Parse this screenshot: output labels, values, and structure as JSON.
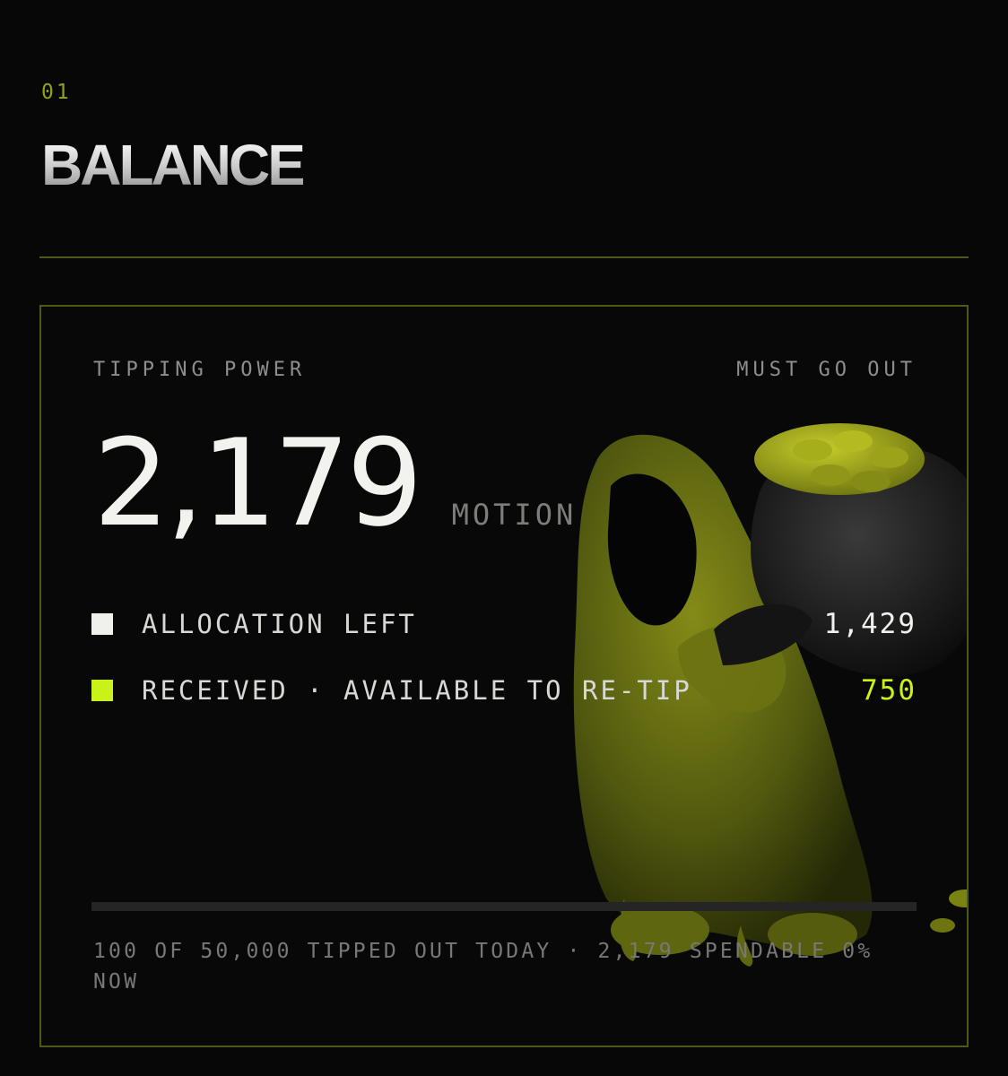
{
  "section": {
    "number": "01",
    "title": "BALANCE"
  },
  "card": {
    "left_label": "TIPPING POWER",
    "right_label": "MUST GO OUT",
    "amount": "2,179",
    "unit": "MOTION",
    "rows": [
      {
        "label": "ALLOCATION LEFT",
        "value": "1,429",
        "swatch_color": "#f0f0ec",
        "value_color": "#f0f0ec"
      },
      {
        "label": "RECEIVED · AVAILABLE TO RE-TIP",
        "value": "750",
        "swatch_color": "#c9f21a",
        "value_color": "#c9f21a"
      }
    ],
    "progress_fraction": 0,
    "footer": "100 OF 50,000 TIPPED OUT TODAY · 2,179 SPENDABLE 0% NOW",
    "mascot_icon": "hooded-figure-with-coin-sack-icon"
  },
  "colors": {
    "accent": "#c9f21a",
    "accent_dim": "#8fa21f",
    "border": "#4c5a18",
    "background": "#070707"
  }
}
